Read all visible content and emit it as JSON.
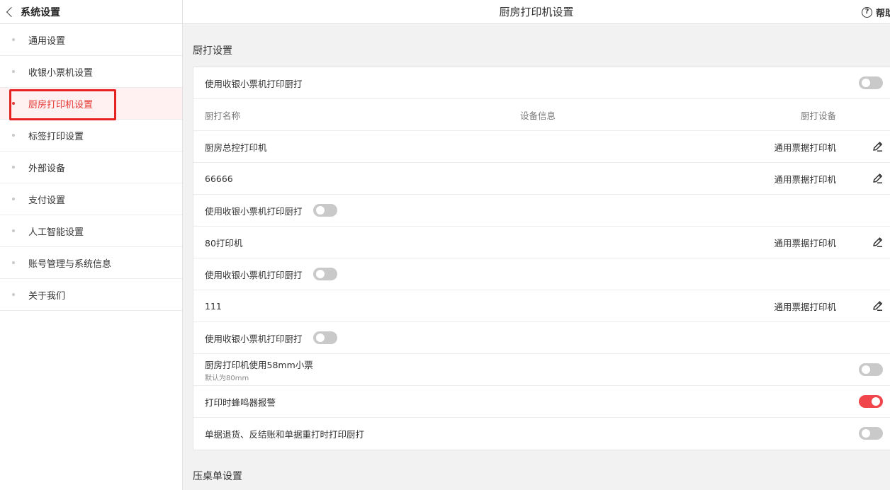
{
  "header": {
    "back_title": "系统设置",
    "page_title": "厨房打印机设置",
    "help_label": "帮助"
  },
  "sidebar": {
    "items": [
      {
        "label": "通用设置"
      },
      {
        "label": "收银小票机设置"
      },
      {
        "label": "厨房打印机设置",
        "active": true
      },
      {
        "label": "标签打印设置"
      },
      {
        "label": "外部设备"
      },
      {
        "label": "支付设置"
      },
      {
        "label": "人工智能设置"
      },
      {
        "label": "账号管理与系统信息"
      },
      {
        "label": "关于我们"
      }
    ]
  },
  "main": {
    "section1_title": "厨打设置",
    "use_receipt_printer": {
      "label": "使用收银小票机打印厨打",
      "enabled": false
    },
    "table_header": {
      "name": "厨打名称",
      "info": "设备信息",
      "device": "厨打设备"
    },
    "printers": [
      {
        "name": "厨房总控打印机",
        "device": "通用票据打印机"
      },
      {
        "name": "66666",
        "device": "通用票据打印机",
        "sub_label": "使用收银小票机打印厨打",
        "sub_enabled": false
      },
      {
        "name": "80打印机",
        "device": "通用票据打印机",
        "sub_label": "使用收银小票机打印厨打",
        "sub_enabled": false
      },
      {
        "name": "111",
        "device": "通用票据打印机",
        "sub_label": "使用收银小票机打印厨打",
        "sub_enabled": false
      }
    ],
    "opt_58mm": {
      "label": "厨房打印机使用58mm小票",
      "hint": "默认为80mm",
      "enabled": false
    },
    "opt_buzzer": {
      "label": "打印时蜂鸣器报警",
      "enabled": true
    },
    "opt_reprint": {
      "label": "单据退货、反结账和单据重打时打印厨打",
      "enabled": false
    },
    "section2_title": "压桌单设置"
  },
  "colors": {
    "accent": "#e53935",
    "toggle_on": "#f0454a",
    "toggle_off": "#c9c9c9"
  }
}
